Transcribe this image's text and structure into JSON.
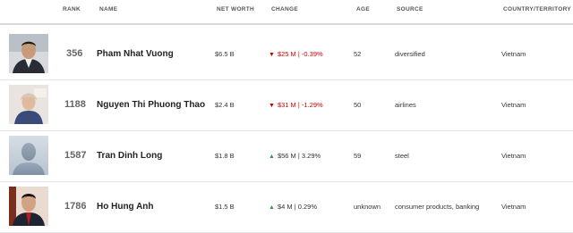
{
  "columns": {
    "rank": "RANK",
    "name": "NAME",
    "net_worth": "NET WORTH",
    "change": "CHANGE",
    "age": "AGE",
    "source": "SOURCE",
    "country": "COUNTRY/TERRITORY"
  },
  "rows": [
    {
      "rank": "356",
      "name": "Pham Nhat Vuong",
      "net_worth": "$6.5 B",
      "direction": "down",
      "change": "$25 M | -0.39%",
      "age": "52",
      "source": "diversified",
      "country": "Vietnam",
      "photo": "person-photo-icon"
    },
    {
      "rank": "1188",
      "name": "Nguyen Thi Phuong Thao",
      "net_worth": "$2.4 B",
      "direction": "down",
      "change": "$31 M | -1.29%",
      "age": "50",
      "source": "airlines",
      "country": "Vietnam",
      "photo": "person-photo-icon"
    },
    {
      "rank": "1587",
      "name": "Tran Dinh Long",
      "net_worth": "$1.8 B",
      "direction": "up",
      "change": "$56 M | 3.29%",
      "age": "59",
      "source": "steel",
      "country": "Vietnam",
      "photo": "placeholder-silhouette-icon"
    },
    {
      "rank": "1786",
      "name": "Ho Hung Anh",
      "net_worth": "$1.5 B",
      "direction": "up",
      "change": "$4 M | 0.29%",
      "age": "unknown",
      "source": "consumer products, banking",
      "country": "Vietnam",
      "photo": "person-photo-icon"
    }
  ],
  "colors": {
    "down": "#cc0000",
    "up": "#2e9e44"
  }
}
